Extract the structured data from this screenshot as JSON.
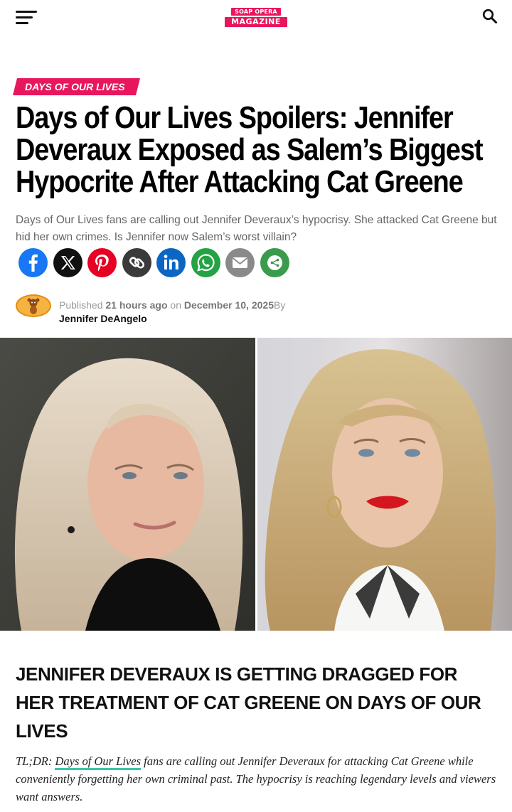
{
  "header": {
    "logo_top": "SOAP OPERA",
    "logo_bottom": "MAGAZINE",
    "menu_icon": "hamburger-menu-icon",
    "search_icon": "search-icon"
  },
  "colors": {
    "accent": "#e8175d",
    "link_underline": "#3bc6a8"
  },
  "article": {
    "category": "DAYS OF OUR LIVES",
    "title": "Days of Our Lives Spoilers: Jennifer Deveraux Exposed as Salem’s Biggest Hypocrite After Attacking Cat Greene",
    "subtitle": "Days of Our Lives fans are calling out Jennifer Deveraux’s hypocrisy. She attacked Cat Greene but hid her own crimes. Is Jennifer now Salem’s worst villain?",
    "share": [
      {
        "name": "facebook",
        "color": "#1877f2",
        "icon": "facebook-icon"
      },
      {
        "name": "x",
        "color": "#111111",
        "icon": "x-icon"
      },
      {
        "name": "pinterest",
        "color": "#e60023",
        "icon": "pinterest-icon"
      },
      {
        "name": "copy-link",
        "color": "#3a3a3a",
        "icon": "link-icon"
      },
      {
        "name": "linkedin",
        "color": "#0a66c2",
        "icon": "linkedin-icon"
      },
      {
        "name": "whatsapp",
        "color": "#25a244",
        "icon": "whatsapp-icon"
      },
      {
        "name": "email",
        "color": "#8a8a8a",
        "icon": "email-icon"
      },
      {
        "name": "more",
        "color": "#3a9b4c",
        "icon": "share-more-icon"
      }
    ],
    "byline": {
      "published_label": "Published",
      "relative_time": "21 hours ago",
      "on_label": "on",
      "date": "December 10, 2025",
      "by_label": "By",
      "author": "Jennifer DeAngelo"
    },
    "section_heading": "JENNIFER DEVERAUX IS GETTING DRAGGED FOR HER TREATMENT OF CAT GREENE ON DAYS OF OUR LIVES",
    "tldr": {
      "prefix": "TL;DR: ",
      "link_text": "Days of Our Lives",
      "rest": " fans are calling out Jennifer Deveraux for attacking Cat Greene while conveniently forgetting her own criminal past. The hypocrisy is reaching legendary levels and viewers want answers."
    }
  }
}
